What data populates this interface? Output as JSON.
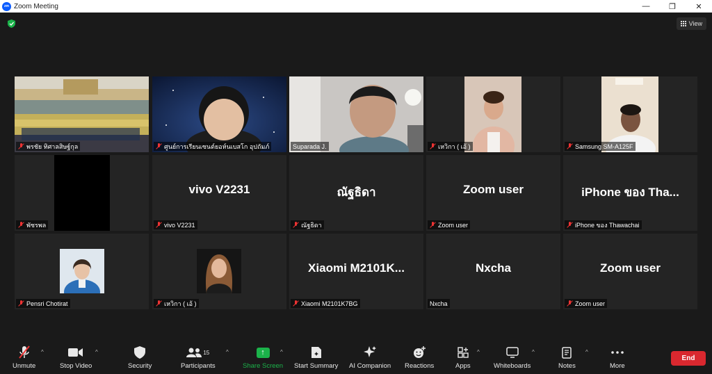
{
  "window": {
    "title": "Zoom Meeting",
    "logo_text": "zm"
  },
  "top_right": {
    "view_label": "View"
  },
  "tiles": [
    {
      "name": "พรชัย ทิศาลสิษฐ์กุล",
      "display": "",
      "muted": true,
      "type": "video-hall"
    },
    {
      "name": "ศูนย์การเรียนเซนต์ยอห์นเบสโก อุปถัมภ์",
      "display": "",
      "muted": true,
      "type": "video-person"
    },
    {
      "name": "Suparada J.",
      "display": "",
      "muted": false,
      "type": "video-person"
    },
    {
      "name": "เหวิกา ( เอ้ )",
      "display": "",
      "muted": true,
      "type": "video-person"
    },
    {
      "name": "Samsung SM-A125F",
      "display": "",
      "muted": true,
      "type": "video-person"
    },
    {
      "name": "พัชรพล",
      "display": "",
      "muted": true,
      "type": "black-video"
    },
    {
      "name": "vivo V2231",
      "display": "vivo V2231",
      "muted": true,
      "type": "name"
    },
    {
      "name": "ณัฐธิดา",
      "display": "ณัฐธิดา",
      "muted": true,
      "type": "name"
    },
    {
      "name": "Zoom user",
      "display": "Zoom user",
      "muted": true,
      "type": "name"
    },
    {
      "name": "iPhone ของ Thawachai",
      "display": "iPhone ของ Tha...",
      "muted": true,
      "type": "name"
    },
    {
      "name": "Pensri Chotirat",
      "display": "",
      "muted": true,
      "type": "avatar"
    },
    {
      "name": "เหวิกา ( เอ้ )",
      "display": "",
      "muted": true,
      "type": "avatar"
    },
    {
      "name": "Xiaomi M2101K7BG",
      "display": "Xiaomi  M2101K...",
      "muted": true,
      "type": "name"
    },
    {
      "name": "Nxcha",
      "display": "Nxcha",
      "muted": false,
      "type": "name"
    },
    {
      "name": "Zoom user",
      "display": "Zoom user",
      "muted": true,
      "type": "name"
    }
  ],
  "toolbar": {
    "unmute": "Unmute",
    "stop_video": "Stop Video",
    "security": "Security",
    "participants": "Participants",
    "participants_count": "15",
    "share_screen": "Share Screen",
    "start_summary": "Start Summary",
    "ai_companion": "AI Companion",
    "reactions": "Reactions",
    "apps": "Apps",
    "whiteboards": "Whiteboards",
    "notes": "Notes",
    "more": "More",
    "end": "End"
  },
  "colors": {
    "active_speaker": "#b3df3a",
    "share_green": "#1bb34a",
    "end_red": "#d9282f",
    "mute_red": "#e33333"
  }
}
